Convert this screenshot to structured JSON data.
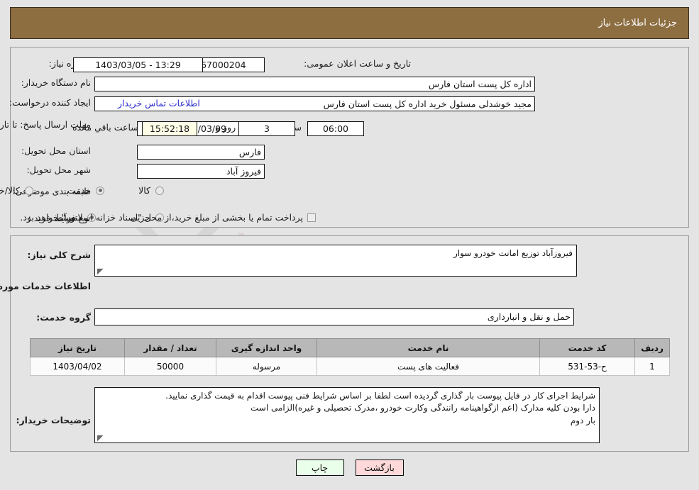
{
  "header": {
    "title": "جزئیات اطلاعات نیاز"
  },
  "fields": {
    "need_number_label": "شماره نیاز:",
    "need_number_value": "1103001067000204",
    "announce_label": "تاریخ و ساعت اعلان عمومی:",
    "announce_value": "13:29 - 1403/03/05",
    "buyer_org_label": "نام دستگاه خریدار:",
    "buyer_org_value": "اداره کل پست استان فارس",
    "requester_label": "ایجاد کننده درخواست:",
    "requester_value": "مجید خوشدلی مسئول خرید اداره کل پست استان فارس",
    "contact_link": "اطلاعات تماس خریدار",
    "deadline_label": "مهلت ارسال پاسخ: تا تاریخ:",
    "deadline_date": "1403/03/09",
    "hour_label": "ساعت",
    "deadline_time": "06:00",
    "days_value": "3",
    "days_label": "روز و",
    "countdown_value": "15:52:18",
    "countdown_label": "ساعت باقي مانده",
    "province_label": "استان محل تحویل:",
    "province_value": "فارس",
    "city_label": "شهر محل تحویل:",
    "city_value": "فیروز آباد",
    "category_label": "طبقه بندی موضوعی:",
    "process_label": "نوع فرآیند خرید :",
    "treasury_note": "پرداخت تمام یا بخشی از مبلغ خرید،از محل \"اسناد خزانه اسلامی\" خواهد بود."
  },
  "category_options": [
    {
      "label": "کالا",
      "selected": false
    },
    {
      "label": "خدمت",
      "selected": true
    },
    {
      "label": "کالا/خدمت",
      "selected": false
    }
  ],
  "process_options": [
    {
      "label": "جزیی",
      "selected": false
    },
    {
      "label": "متوسط",
      "selected": true
    }
  ],
  "detail": {
    "summary_label": "شرح کلی نیاز:",
    "summary_value": "فیروزآباد توزیع امانت خودرو سوار",
    "services_heading": "اطلاعات خدمات مورد نیاز",
    "service_group_label": "گروه خدمت:",
    "service_group_value": "حمل و نقل و انبارداری",
    "buyer_notes_label": "توضیحات خریدار:",
    "buyer_notes_line1": "شرایط اجرای کار در فایل پیوست بار گذاری گردیده است لطفا بر اساس شرایط فنی پیوست اقدام به قیمت گذاری نمایید.",
    "buyer_notes_line2": "دارا بودن کلیه مدارک (اعم ازگواهینامه رانندگی وکارت خودرو ،مدرک تحصیلی و غیره)الزامی است",
    "buyer_notes_line3": "بار دوم"
  },
  "table": {
    "columns": [
      "ردیف",
      "کد خدمت",
      "نام خدمت",
      "واحد اندازه گیری",
      "تعداد / مقدار",
      "تاریخ نیاز"
    ],
    "rows": [
      {
        "index": "1",
        "service_code": "ح-53-531",
        "service_name": "فعالیت های پست",
        "unit": "مرسوله",
        "quantity": "50000",
        "need_date": "1403/04/02"
      }
    ]
  },
  "buttons": {
    "print": "چاپ",
    "back": "بازگشت"
  },
  "watermark": {
    "brand": "AriaTender",
    "suffix": ".net"
  }
}
